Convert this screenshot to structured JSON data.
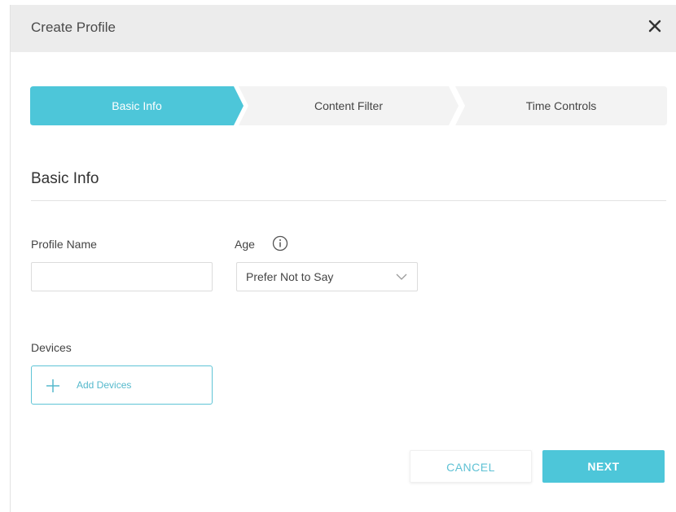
{
  "dialog": {
    "title": "Create Profile"
  },
  "stepper": {
    "steps": [
      {
        "label": "Basic Info",
        "active": true
      },
      {
        "label": "Content Filter",
        "active": false
      },
      {
        "label": "Time Controls",
        "active": false
      }
    ]
  },
  "section": {
    "title": "Basic Info"
  },
  "form": {
    "profile_name_label": "Profile Name",
    "profile_name_value": "",
    "age_label": "Age",
    "age_selected": "Prefer Not to Say",
    "devices_label": "Devices",
    "add_devices_label": "Add Devices"
  },
  "actions": {
    "cancel_label": "CANCEL",
    "next_label": "NEXT"
  },
  "colors": {
    "accent": "#4dc6d9",
    "header_bg": "#ececec",
    "inactive_step_bg": "#f3f3f3"
  },
  "icons": {
    "close": "close-icon",
    "info": "info-icon",
    "chevron": "chevron-down-icon",
    "plus": "plus-icon"
  }
}
